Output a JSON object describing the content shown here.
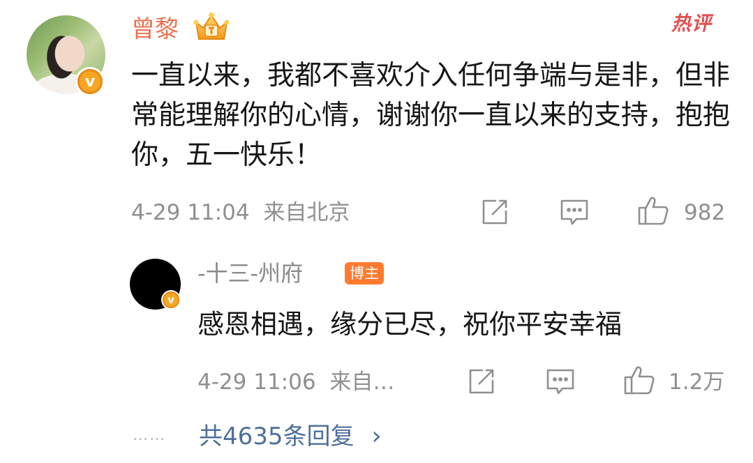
{
  "main_comment": {
    "author": "曾黎",
    "hot_label": "热评",
    "text": "一直以来，我都不喜欢介入任何争端与是非，但非常能理解你的心情，谢谢你一直以来的支持，抱抱你，五一快乐！",
    "timestamp": "4-29 11:04",
    "location": "来自北京",
    "like_count": "982",
    "verified_mark": "v"
  },
  "reply": {
    "author": "-十三-州府",
    "badge": "博主",
    "text": "感恩相遇，缘分已尽，祝你平安幸福",
    "timestamp": "4-29 11:06",
    "location": "来自…",
    "like_count": "1.2万",
    "verified_mark": "v"
  },
  "footer": {
    "dots": "……",
    "more_replies": "共4635条回复",
    "chevron": "›"
  },
  "icons": [
    "crown-icon",
    "share-icon",
    "comment-icon",
    "like-icon",
    "chevron-right-icon"
  ],
  "colors": {
    "author_name": "#eb7350",
    "hot_tag": "#e0504e",
    "meta_gray": "#8f8f8f",
    "link_blue": "#4e6f9c",
    "blogger_badge": "#ff7a2f",
    "verified": "#f5a623"
  }
}
